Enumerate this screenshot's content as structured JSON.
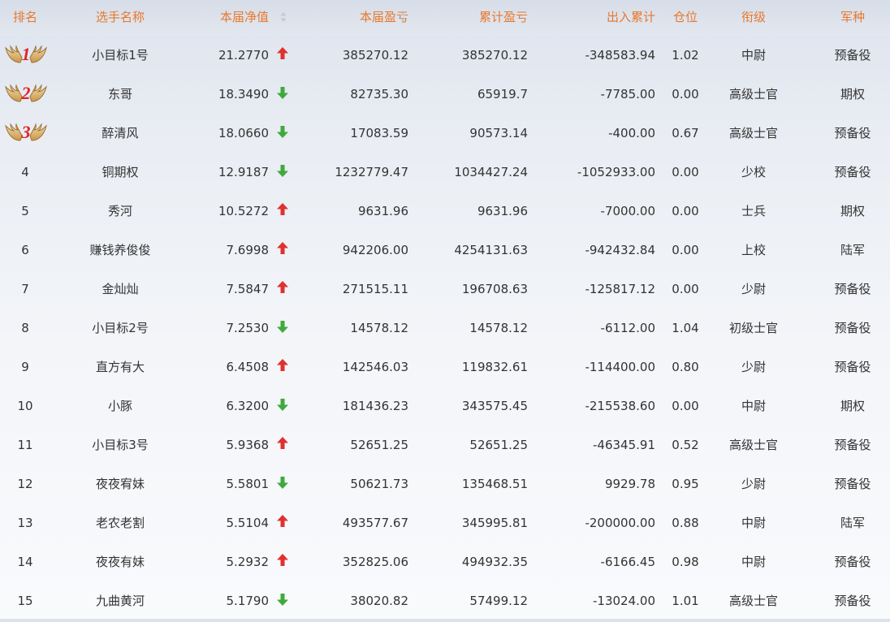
{
  "header": {
    "rank": "排名",
    "name": "选手名称",
    "nav": "本届净值",
    "period_pl": "本届盈亏",
    "cumulative_pl": "累计盈亏",
    "net_flow": "出入累计",
    "position": "仓位",
    "title": "衔级",
    "army": "军种"
  },
  "colors": {
    "header_text": "#e8782c",
    "up_arrow": "#e0312f",
    "down_arrow": "#3faa3c",
    "medal_number": "#e02424"
  },
  "icons": {
    "up": "arrow-up-icon",
    "down": "arrow-down-icon",
    "sort": "sort-icon",
    "medal": "wings-medal-icon"
  },
  "rows": [
    {
      "rank": "1",
      "name": "小目标1号",
      "nav": "21.2770",
      "trend": "up",
      "pl": "385270.12",
      "cum": "385270.12",
      "flow": "-348583.94",
      "pos": "1.02",
      "title": "中尉",
      "army": "预备役"
    },
    {
      "rank": "2",
      "name": "东哥",
      "nav": "18.3490",
      "trend": "down",
      "pl": "82735.30",
      "cum": "65919.7",
      "flow": "-7785.00",
      "pos": "0.00",
      "title": "高级士官",
      "army": "期权"
    },
    {
      "rank": "3",
      "name": "醉清风",
      "nav": "18.0660",
      "trend": "down",
      "pl": "17083.59",
      "cum": "90573.14",
      "flow": "-400.00",
      "pos": "0.67",
      "title": "高级士官",
      "army": "预备役"
    },
    {
      "rank": "4",
      "name": "铜期权",
      "nav": "12.9187",
      "trend": "down",
      "pl": "1232779.47",
      "cum": "1034427.24",
      "flow": "-1052933.00",
      "pos": "0.00",
      "title": "少校",
      "army": "预备役"
    },
    {
      "rank": "5",
      "name": "秀河",
      "nav": "10.5272",
      "trend": "up",
      "pl": "9631.96",
      "cum": "9631.96",
      "flow": "-7000.00",
      "pos": "0.00",
      "title": "士兵",
      "army": "期权"
    },
    {
      "rank": "6",
      "name": "赚钱养俊俊",
      "nav": "7.6998",
      "trend": "up",
      "pl": "942206.00",
      "cum": "4254131.63",
      "flow": "-942432.84",
      "pos": "0.00",
      "title": "上校",
      "army": "陆军"
    },
    {
      "rank": "7",
      "name": "金灿灿",
      "nav": "7.5847",
      "trend": "up",
      "pl": "271515.11",
      "cum": "196708.63",
      "flow": "-125817.12",
      "pos": "0.00",
      "title": "少尉",
      "army": "预备役"
    },
    {
      "rank": "8",
      "name": "小目标2号",
      "nav": "7.2530",
      "trend": "down",
      "pl": "14578.12",
      "cum": "14578.12",
      "flow": "-6112.00",
      "pos": "1.04",
      "title": "初级士官",
      "army": "预备役"
    },
    {
      "rank": "9",
      "name": "直方有大",
      "nav": "6.4508",
      "trend": "up",
      "pl": "142546.03",
      "cum": "119832.61",
      "flow": "-114400.00",
      "pos": "0.80",
      "title": "少尉",
      "army": "预备役"
    },
    {
      "rank": "10",
      "name": "小豚",
      "nav": "6.3200",
      "trend": "down",
      "pl": "181436.23",
      "cum": "343575.45",
      "flow": "-215538.60",
      "pos": "0.00",
      "title": "中尉",
      "army": "期权"
    },
    {
      "rank": "11",
      "name": "小目标3号",
      "nav": "5.9368",
      "trend": "up",
      "pl": "52651.25",
      "cum": "52651.25",
      "flow": "-46345.91",
      "pos": "0.52",
      "title": "高级士官",
      "army": "预备役"
    },
    {
      "rank": "12",
      "name": "夜夜宥妹",
      "nav": "5.5801",
      "trend": "down",
      "pl": "50621.73",
      "cum": "135468.51",
      "flow": "9929.78",
      "pos": "0.95",
      "title": "少尉",
      "army": "预备役"
    },
    {
      "rank": "13",
      "name": "老农老割",
      "nav": "5.5104",
      "trend": "up",
      "pl": "493577.67",
      "cum": "345995.81",
      "flow": "-200000.00",
      "pos": "0.88",
      "title": "中尉",
      "army": "陆军"
    },
    {
      "rank": "14",
      "name": "夜夜有妹",
      "nav": "5.2932",
      "trend": "up",
      "pl": "352825.06",
      "cum": "494932.35",
      "flow": "-6166.45",
      "pos": "0.98",
      "title": "中尉",
      "army": "预备役"
    },
    {
      "rank": "15",
      "name": "九曲黄河",
      "nav": "5.1790",
      "trend": "down",
      "pl": "38020.82",
      "cum": "57499.12",
      "flow": "-13024.00",
      "pos": "1.01",
      "title": "高级士官",
      "army": "预备役"
    }
  ]
}
